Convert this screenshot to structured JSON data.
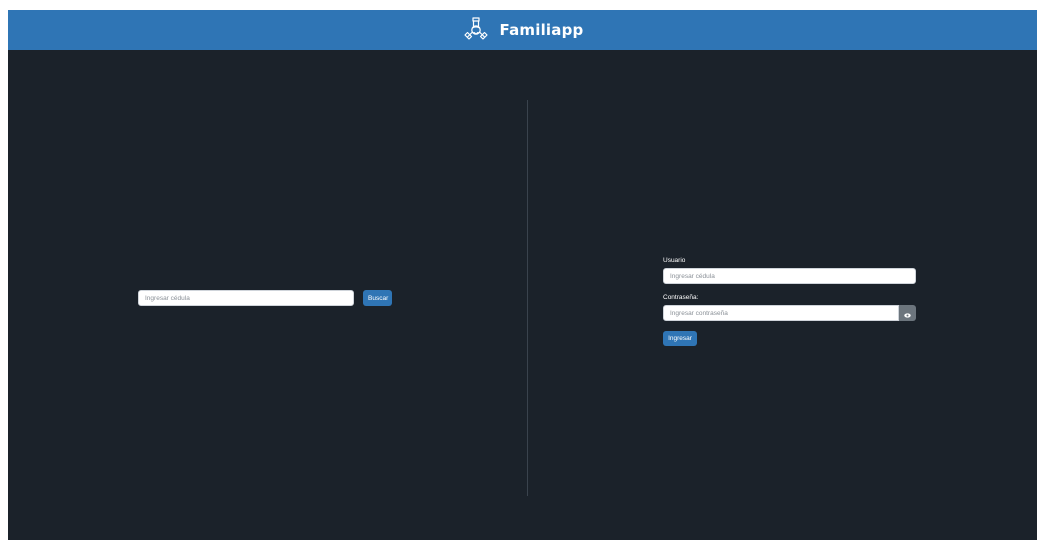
{
  "header": {
    "app_title": "Familiapp",
    "logo_icon": "family-hands-icon",
    "background_color": "#2f75b5"
  },
  "search": {
    "input_placeholder": "Ingresar cédula",
    "input_value": "",
    "button_label": "Buscar"
  },
  "login": {
    "user_label": "Usuario",
    "user_placeholder": "Ingresar cédula",
    "user_value": "",
    "password_label": "Contraseña:",
    "password_placeholder": "Ingresar contraseña",
    "password_value": "",
    "toggle_icon": "eye-icon",
    "submit_label": "Ingresar"
  },
  "colors": {
    "page_background": "#1b222a",
    "accent": "#2f75b5",
    "toggle_button": "#6c757d"
  }
}
